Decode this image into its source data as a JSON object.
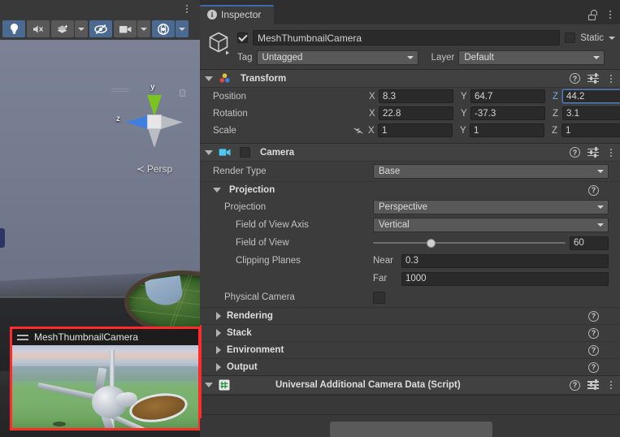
{
  "scene_view": {
    "toolbar": {
      "overflow_menu": "kebab-menu",
      "buttons": [
        {
          "name": "toggle-scene-lighting",
          "icon": "lightbulb-icon",
          "active": true
        },
        {
          "name": "toggle-audio",
          "icon": "audio-muted-icon",
          "active": false
        },
        {
          "name": "toggle-fx",
          "icon": "fx-icon",
          "active": false,
          "has_dropdown": true
        },
        {
          "name": "toggle-hidden-objects",
          "icon": "eye-crossed-icon",
          "active": true
        },
        {
          "name": "scene-camera",
          "icon": "camera-icon",
          "active": false,
          "has_dropdown": true
        },
        {
          "name": "gizmos-toggle",
          "icon": "gizmo-globe-icon",
          "active": true,
          "has_dropdown": true
        }
      ]
    },
    "gizmo": {
      "axis_y_label": "y",
      "axis_z_label": "z",
      "projection_label": "Persp",
      "projection_arrow": "≺",
      "color_y": "#7ac420",
      "color_z": "#3f7fe0",
      "color_neutral": "#b9bcc2"
    },
    "camera_preview": {
      "title": "MeshThumbnailCamera",
      "highlight_color": "#ff2a2a",
      "grip_icon": "drag-handle-icon"
    }
  },
  "inspector": {
    "tab": {
      "label": "Inspector",
      "icon": "info-icon",
      "accent_color": "#3b6ba8"
    },
    "lock_icon": "lock-open-icon",
    "menu_icon": "kebab-menu-icon",
    "object_header": {
      "icon": "cube-prefab-icon",
      "enabled": true,
      "name": "MeshThumbnailCamera",
      "static_label": "Static",
      "static_checked": false,
      "tag_label": "Tag",
      "tag_value": "Untagged",
      "layer_label": "Layer",
      "layer_value": "Default"
    },
    "components": [
      {
        "id": "transform",
        "title": "Transform",
        "icon": "transform-axis-icon",
        "expanded": true,
        "help_icon": "help-icon",
        "preset_icon": "preset-icon",
        "menu_icon": "kebab-menu-icon",
        "rows": [
          {
            "label": "Position",
            "axes": [
              {
                "letter": "X",
                "value": "8.3",
                "focused": false
              },
              {
                "letter": "Y",
                "value": "64.7",
                "focused": false
              },
              {
                "letter": "Z",
                "value": "44.2",
                "focused": true
              }
            ]
          },
          {
            "label": "Rotation",
            "axes": [
              {
                "letter": "X",
                "value": "22.8",
                "focused": false
              },
              {
                "letter": "Y",
                "value": "-37.3",
                "focused": false
              },
              {
                "letter": "Z",
                "value": "3.1",
                "focused": false
              }
            ]
          },
          {
            "label": "Scale",
            "link_icon": "scale-unlinked-icon",
            "axes": [
              {
                "letter": "X",
                "value": "1",
                "focused": false
              },
              {
                "letter": "Y",
                "value": "1",
                "focused": false
              },
              {
                "letter": "Z",
                "value": "1",
                "focused": false
              }
            ]
          }
        ]
      },
      {
        "id": "camera",
        "title": "Camera",
        "icon": "camera-component-icon",
        "icon_color": "#4ec8f0",
        "enabled": false,
        "expanded": true,
        "help_icon": "help-icon",
        "preset_icon": "preset-icon",
        "menu_icon": "kebab-menu-icon",
        "render_type_label": "Render Type",
        "render_type_value": "Base",
        "projection_section": {
          "title": "Projection",
          "expanded": true,
          "help_icon": "help-icon",
          "projection_label": "Projection",
          "projection_value": "Perspective",
          "fov_axis_label": "Field of View Axis",
          "fov_axis_value": "Vertical",
          "fov_label": "Field of View",
          "fov_value": "60",
          "fov_slider_percent": 30,
          "clipping_label": "Clipping Planes",
          "near_label": "Near",
          "near_value": "0.3",
          "far_label": "Far",
          "far_value": "1000",
          "physical_camera_label": "Physical Camera",
          "physical_camera_checked": false
        },
        "collapsed_sections": [
          {
            "label": "Rendering",
            "help_icon": "help-icon"
          },
          {
            "label": "Stack",
            "help_icon": "help-icon"
          },
          {
            "label": "Environment",
            "help_icon": "help-icon"
          },
          {
            "label": "Output",
            "help_icon": "help-icon"
          }
        ]
      },
      {
        "id": "urp-additional-camera-data",
        "title": "Universal Additional Camera Data (Script)",
        "icon": "script-icon",
        "icon_color": "#3fae5c",
        "expanded": true,
        "help_icon": "help-icon",
        "preset_icon": "preset-icon",
        "menu_icon": "kebab-menu-icon"
      }
    ]
  }
}
